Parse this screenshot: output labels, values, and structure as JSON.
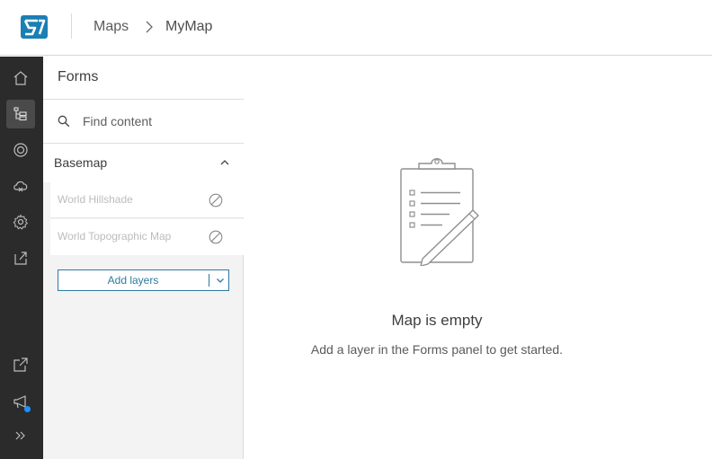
{
  "header": {
    "logo": "app-logo-icon",
    "breadcrumb": [
      "Maps",
      "MyMap"
    ]
  },
  "rail": {
    "top": [
      "home-icon",
      "layers-tree-icon",
      "target-icon",
      "cloud-icon",
      "gear-icon",
      "share-icon"
    ],
    "bottom": [
      "open-external-icon",
      "announcement-icon",
      "expand-icon"
    ],
    "active": "layers-tree-icon"
  },
  "panel": {
    "title": "Forms",
    "search": {
      "placeholder": "Find content",
      "value": ""
    },
    "basemap": {
      "title": "Basemap",
      "layers": [
        {
          "label": "World Hillshade",
          "icon": "disabled-icon"
        },
        {
          "label": "World Topographic Map",
          "icon": "disabled-icon"
        }
      ]
    },
    "add_layers_label": "Add layers"
  },
  "main": {
    "empty_title": "Map is empty",
    "empty_subtitle": "Add a layer in the Forms panel to get started."
  },
  "colors": {
    "accent": "#2b7a9e",
    "rail_bg": "#2b2b2b",
    "notification": "#1e90ff",
    "logo": "#1a7fb3"
  }
}
